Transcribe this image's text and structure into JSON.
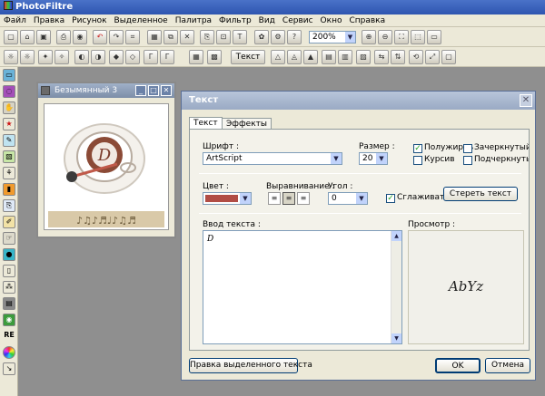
{
  "app": {
    "title": "PhotoFiltre",
    "menu": [
      "Файл",
      "Правка",
      "Рисунок",
      "Выделенное",
      "Палитра",
      "Фильтр",
      "Вид",
      "Сервис",
      "Окно",
      "Справка"
    ],
    "zoom": "200%",
    "text_tool_label": "Текст"
  },
  "image_window": {
    "title": "Безымянный 3",
    "minimize_glyph": "_",
    "maximize_glyph": "□",
    "close_glyph": "✕"
  },
  "dialog": {
    "title": "Текст",
    "close_glyph": "✕",
    "tabs": [
      {
        "label": "Текст",
        "active": true
      },
      {
        "label": "Эффекты",
        "active": false
      }
    ],
    "font_label": "Шрифт :",
    "font_value": "ArtScript",
    "size_label": "Размер :",
    "size_value": "20",
    "bold_label": "Полужирнь",
    "italic_label": "Курсив",
    "strike_label": "Зачеркнутый",
    "underline_label": "Подчеркнуть",
    "color_label": "Цвет :",
    "color_value": "#b14d45",
    "align_label": "Выравнивание :",
    "angle_label": "Угол :",
    "angle_value": "0",
    "smooth_label": "Сглаживат",
    "clear_button": "Стереть текст",
    "input_label": "Ввод текста :",
    "input_value": "D",
    "preview_label": "Просмотр :",
    "preview_text": "AbYz",
    "edit_selected_button": "Правка выделенного текста",
    "ok_button": "OK",
    "cancel_button": "Отмена"
  }
}
